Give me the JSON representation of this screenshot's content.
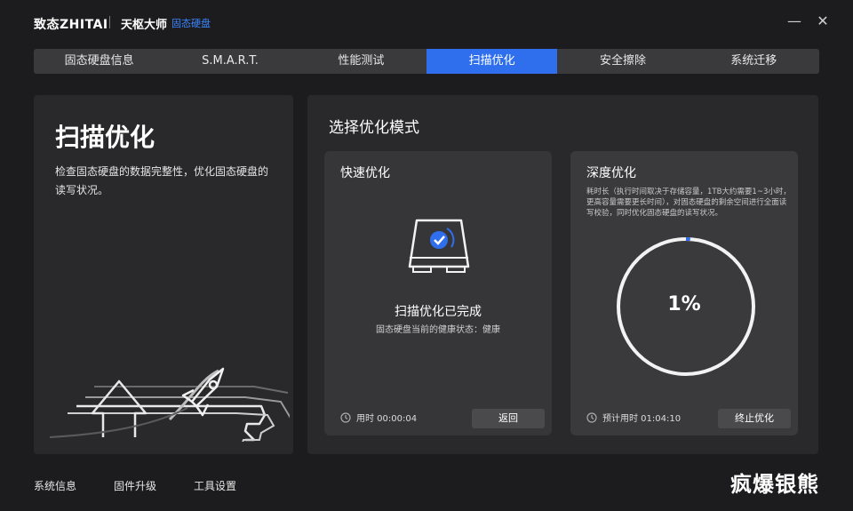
{
  "header": {
    "brand": "致态ZHITAI",
    "app_name": "天枢大师",
    "app_sub": "固态硬盘",
    "minimize": "—",
    "close": "✕"
  },
  "tabs": [
    {
      "label": "固态硬盘信息"
    },
    {
      "label": "S.M.A.R.T."
    },
    {
      "label": "性能测试"
    },
    {
      "label": "扫描优化",
      "active": true
    },
    {
      "label": "安全擦除"
    },
    {
      "label": "系统迁移"
    }
  ],
  "left": {
    "title": "扫描优化",
    "description": "检查固态硬盘的数据完整性，优化固态硬盘的读写状况。"
  },
  "right": {
    "title": "选择优化模式",
    "quick": {
      "title": "快速优化",
      "status": "扫描优化已完成",
      "health": "固态硬盘当前的健康状态：健康",
      "time_label": "用时 00:00:04",
      "button": "返回"
    },
    "deep": {
      "title": "深度优化",
      "description": "耗时长（执行时间取决于存储容量，1TB大约需要1~3小时，更高容量需要更长时间），对固态硬盘的剩余空间进行全面读写校验，同时优化固态硬盘的读写状况。",
      "progress_text": "1%",
      "progress": 0.01,
      "time_label": "预计用时 01:04:10",
      "button": "终止优化"
    }
  },
  "bottom_nav": [
    {
      "label": "系统信息"
    },
    {
      "label": "固件升级"
    },
    {
      "label": "工具设置"
    }
  ],
  "watermark": "疯爆银熊",
  "colors": {
    "accent": "#2f6fed",
    "background": "#1c1c1e",
    "panel": "#29292b"
  },
  "icons": [
    "minimize-icon",
    "close-icon",
    "clock-icon",
    "ssd-check-icon",
    "rocket-icon",
    "upload-arrow-icon"
  ]
}
